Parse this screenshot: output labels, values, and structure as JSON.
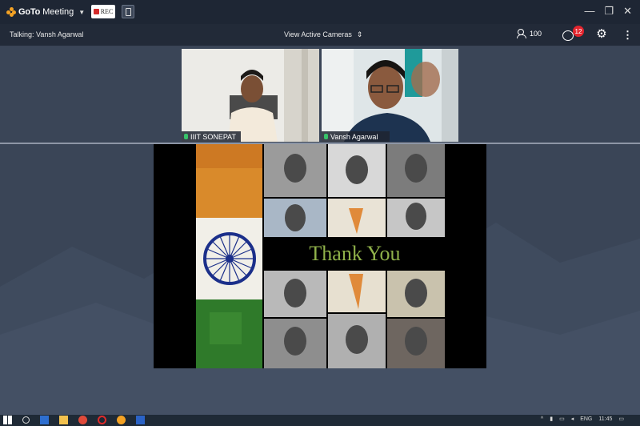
{
  "app": {
    "brand_bold": "GoTo",
    "brand_regular": "Meeting",
    "rec_label": "REC"
  },
  "toolbar": {
    "talking": "Talking: Vansh Agarwal",
    "view_cameras": "View Active Cameras",
    "attendee_count": "100",
    "chat_badge": "12"
  },
  "participants": [
    {
      "name": "IIIT SONEPAT"
    },
    {
      "name": "Vansh Agarwal"
    }
  ],
  "slide": {
    "text": "Thank You"
  },
  "taskbar": {
    "lang": "ENG",
    "time": "11:45"
  },
  "colors": {
    "accent_orange": "#f4a224",
    "rec_red": "#d42a2a",
    "badge_red": "#e3252e",
    "mic_green": "#37c26a",
    "slide_text_green": "#8fb14a"
  },
  "icons": [
    "goto-logo-icon",
    "chevron-down-icon",
    "record-icon",
    "clipboard-icon",
    "minimize-icon",
    "restore-icon",
    "close-icon",
    "sort-icon",
    "attendees-icon",
    "chat-icon",
    "gear-icon",
    "more-vertical-icon",
    "microphone-icon",
    "windows-start-icon",
    "search-icon"
  ]
}
